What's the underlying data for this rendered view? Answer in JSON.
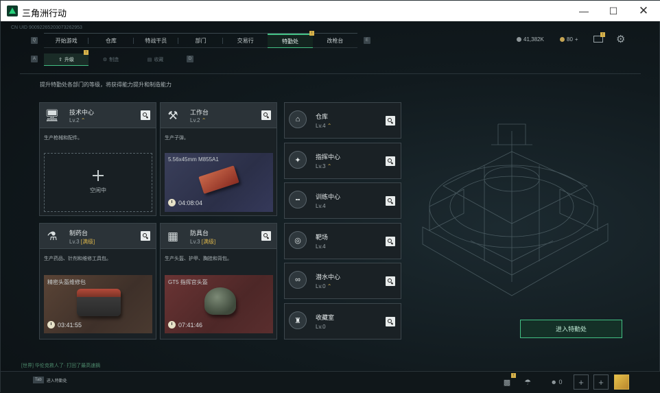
{
  "window": {
    "title": "三角洲行动",
    "controls": [
      "minimize",
      "maximize",
      "close"
    ]
  },
  "uid": "CN UID 90092265203073262953",
  "nav": {
    "left_key": "Q",
    "right_key": "E",
    "tabs": [
      {
        "label": "开始游戏",
        "active": false
      },
      {
        "label": "仓库",
        "active": false
      },
      {
        "label": "特战干员",
        "active": false
      },
      {
        "label": "部门",
        "active": false
      },
      {
        "label": "交易行",
        "active": false
      },
      {
        "label": "特勤处",
        "active": true,
        "badge": "!"
      },
      {
        "label": "改枪台",
        "active": false
      }
    ]
  },
  "currency": {
    "silver": "41,382K",
    "gold": "80",
    "gold_add": "+"
  },
  "subtabs": {
    "left_key": "A",
    "right_key": "D",
    "items": [
      {
        "label": "升级",
        "active": true,
        "badge": "!"
      },
      {
        "label": "制造",
        "active": false
      },
      {
        "label": "收藏",
        "active": false
      }
    ]
  },
  "description": "提升特勤处各部门的等级，将获得能力提升和制造能力",
  "facilities": {
    "tech_center": {
      "name": "技术中心",
      "level": "Lv.2",
      "desc": "生产枪械和配件。",
      "slot_status": "空闲中"
    },
    "workbench": {
      "name": "工作台",
      "level": "Lv.2",
      "desc": "生产子弹。",
      "item": "5.56x45mm M855A1",
      "timer": "04:08:04"
    },
    "pharmacy": {
      "name": "制药台",
      "level": "Lv.3",
      "max": "[满级]",
      "desc": "生产药品、针剂和维修工具包。",
      "item": "精密头盔维修包",
      "timer": "03:41:55"
    },
    "armor_bench": {
      "name": "防具台",
      "level": "Lv.3",
      "max": "[满级]",
      "desc": "生产头盔、护甲、胸挂和背包。",
      "item": "GT5 指挥官头盔",
      "timer": "07:41:46"
    }
  },
  "side_facilities": [
    {
      "name": "仓库",
      "level": "Lv.4",
      "icon": "warehouse-icon",
      "glyph": "⌂",
      "upgradable": true
    },
    {
      "name": "指挥中心",
      "level": "Lv.3",
      "icon": "command-center-icon",
      "glyph": "✦",
      "upgradable": true
    },
    {
      "name": "训练中心",
      "level": "Lv.4",
      "icon": "dumbbell-icon",
      "glyph": "╍",
      "upgradable": false
    },
    {
      "name": "靶场",
      "level": "Lv.4",
      "icon": "target-icon",
      "glyph": "◎",
      "upgradable": false
    },
    {
      "name": "潜水中心",
      "level": "Lv.0",
      "icon": "diving-mask-icon",
      "glyph": "∞",
      "upgradable": true
    },
    {
      "name": "收藏室",
      "level": "Lv.0",
      "icon": "collection-room-icon",
      "glyph": "♜",
      "upgradable": false
    }
  ],
  "enter_button": "进入特勤处",
  "chat": "[世界] 华伦克救人了· 打回了最高速摘",
  "bottom": {
    "key": "Tab",
    "label": "进入特勤处",
    "friends": "0"
  },
  "colors": {
    "accent": "#43c285",
    "gold": "#d7b24a",
    "bg": "#111a1e"
  }
}
